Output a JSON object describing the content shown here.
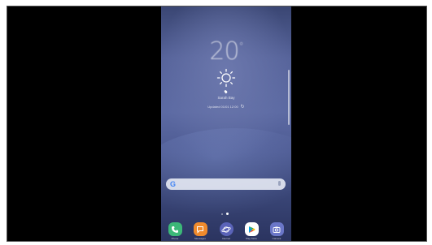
{
  "weather": {
    "temperature": "20",
    "unit": "°",
    "location": "Sarah Bay",
    "updated": "Updated 01/01 12:00",
    "icon": "sun-icon"
  },
  "search": {
    "provider_icon": "G",
    "mic_icon": "mic-icon"
  },
  "dock": {
    "apps": [
      {
        "label": "Phone",
        "icon": "phone-icon",
        "color": "#3cb878"
      },
      {
        "label": "Messages",
        "icon": "messages-icon",
        "color": "#f08a2c"
      },
      {
        "label": "Internet",
        "icon": "internet-icon",
        "color": "#5a63b8"
      },
      {
        "label": "Play Store",
        "icon": "play-store-icon",
        "color": "#ffffff"
      },
      {
        "label": "Camera",
        "icon": "camera-icon",
        "color": "#6a76c8"
      }
    ]
  },
  "colors": {
    "wallpaper_top": "#3a4673",
    "wallpaper_mid": "#5c6aa3",
    "wallpaper_bottom": "#2b3460"
  }
}
